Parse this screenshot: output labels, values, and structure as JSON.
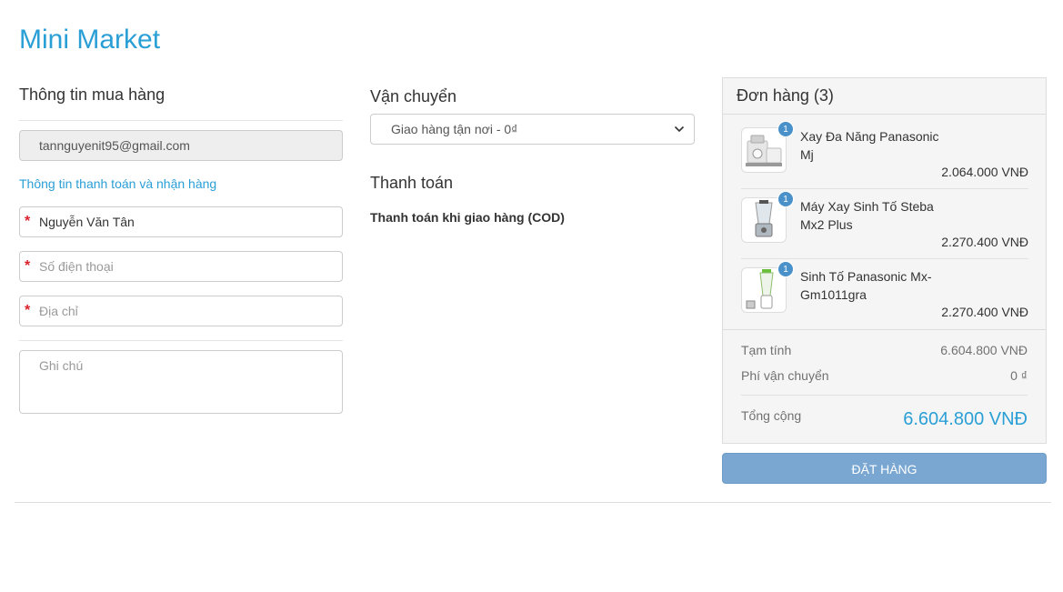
{
  "brand": {
    "name": "Mini Market"
  },
  "customer": {
    "title": "Thông tin mua hàng",
    "email": "tannguyenit95@gmail.com",
    "billing_link": "Thông tin thanh toán và nhận hàng",
    "name_value": "Nguyễn Văn Tân",
    "phone_placeholder": "Số điện thoại",
    "address_placeholder": "Địa chỉ",
    "note_placeholder": "Ghi chú",
    "required_mark": "*"
  },
  "shipping": {
    "title": "Vận chuyển",
    "selected_option": "Giao hàng tận nơi - 0₫"
  },
  "payment": {
    "title": "Thanh toán",
    "method": "Thanh toán khi giao hàng (COD)"
  },
  "order": {
    "title": "Đơn hàng (3)",
    "items": [
      {
        "name": "Xay Đa Năng Panasonic Mj",
        "qty": "1",
        "price": "2.064.000 VNĐ",
        "icon": "food-processor-icon"
      },
      {
        "name": "Máy Xay Sinh Tố Steba Mx2 Plus",
        "qty": "1",
        "price": "2.270.400 VNĐ",
        "icon": "blender-icon"
      },
      {
        "name": "Sinh Tố Panasonic Mx-Gm1011gra",
        "qty": "1",
        "price": "2.270.400 VNĐ",
        "icon": "blender-green-icon"
      }
    ],
    "subtotal_label": "Tạm tính",
    "subtotal_value": "6.604.800 VNĐ",
    "shipping_label": "Phí vận chuyển",
    "shipping_value": "0 ₫",
    "total_label": "Tổng cộng",
    "total_value": "6.604.800 VNĐ",
    "submit_label": "ĐẶT HÀNG"
  },
  "colors": {
    "brand": "#2a9fd6",
    "button": "#7aa7d2",
    "badge": "#4a90c9",
    "required": "#d9212c"
  }
}
